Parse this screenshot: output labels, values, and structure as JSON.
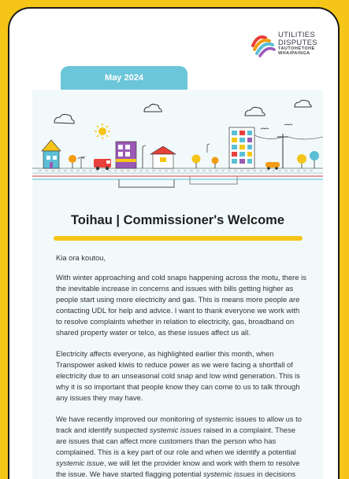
{
  "logo": {
    "line1": "UTILITIES",
    "line2": "DISPUTES",
    "line3": "TAUTOHETOHE",
    "line4": "WHAIPAINGA"
  },
  "tab": {
    "date": "May 2024"
  },
  "heading": {
    "title": "Toihau | Commissioner's Welcome"
  },
  "body": {
    "greeting": "Kia ora koutou,",
    "para1": "With winter approaching and cold snaps happening across the motu, there is the inevitable increase in concerns and issues with bills getting higher as people start using more electricity and gas. This is means more people are contacting UDL for help and advice. I want to thank everyone we work with to resolve complaints whether in relation to electricity, gas, broadband on shared property water or telco, as these issues affect us all.",
    "para2": "Electricity affects everyone, as highlighted earlier this month, when Transpower asked kiwis to reduce power as we were facing a shortfall of electricity due to an unseasonal cold snap and low wind generation. This is why it is so important that people know they can come to us to talk through any issues they may have.",
    "para3_a": "We have recently improved our monitoring of systemic issues to allow us to track and identify suspected ",
    "para3_em1": "systemic issues",
    "para3_b": " raised in a complaint. These are issues that can affect more customers than the person who has complained. This is a key part of our role and when we identify a potential ",
    "para3_em2": "systemic issue",
    "para3_c": ", we will let the provider know and work with them to resolve the issue. We have started flagging potential ",
    "para3_em3": "systemic issues",
    "para3_d": " in decisions and have received positive feedback so far."
  },
  "colors": {
    "background": "#f5c518",
    "tab": "#6cc6d9",
    "panel": "#f2f9fb",
    "rule": "#f5c518"
  }
}
